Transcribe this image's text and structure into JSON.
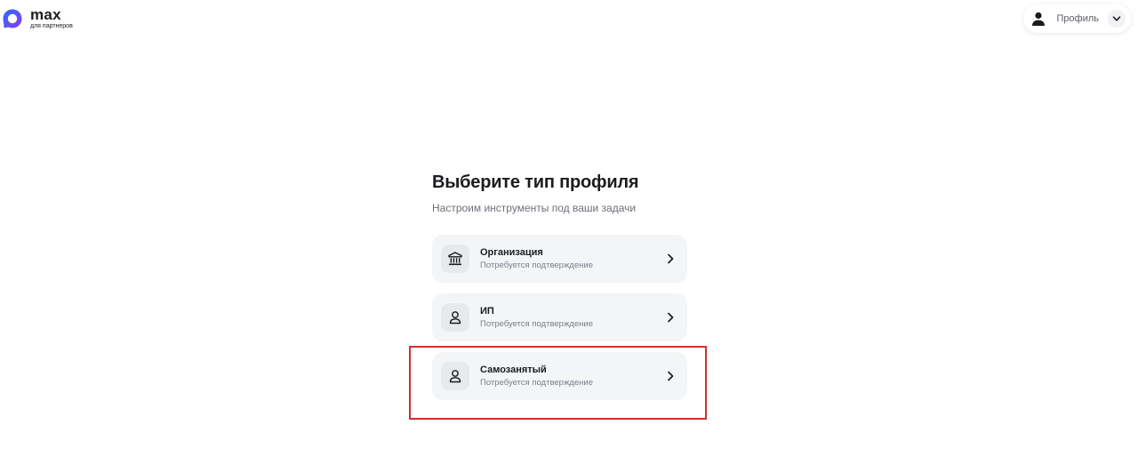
{
  "header": {
    "logo": {
      "name": "max",
      "subtitle": "для партнеров"
    },
    "profile": {
      "label": "Профиль",
      "avatar_icon": "user-avatar-icon",
      "menu_icon": "chevron-down-icon"
    }
  },
  "main": {
    "title": "Выберите тип профиля",
    "subtitle": "Настроим инструменты под ваши задачи",
    "options": [
      {
        "title": "Организация",
        "description": "Потребуется подтверждение",
        "icon": "bank-building-icon"
      },
      {
        "title": "ИП",
        "description": "Потребуется подтверждение",
        "icon": "person-icon"
      },
      {
        "title": "Самозанятый",
        "description": "Потребуется подтверждение",
        "icon": "person-icon"
      }
    ]
  },
  "annotation": {
    "highlighted_option": "Самозанятый",
    "color": "#d32f2f"
  },
  "colors": {
    "card_bg": "#f3f5f7",
    "logo_gradient": [
      "#2b6bff",
      "#8a3cf0"
    ]
  }
}
